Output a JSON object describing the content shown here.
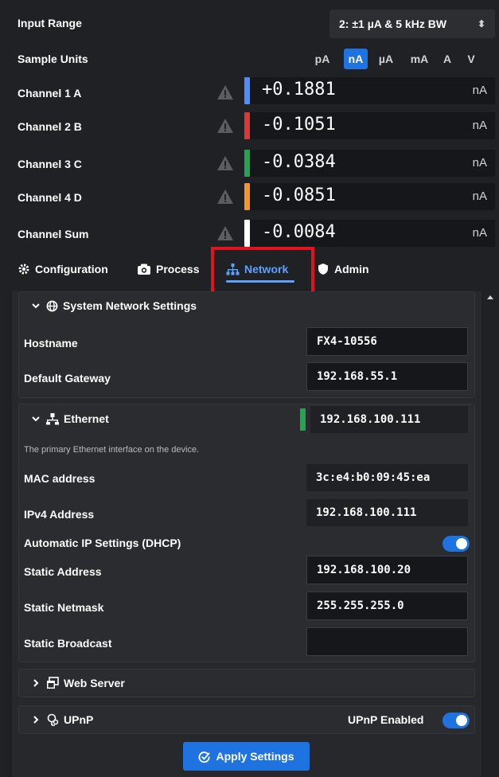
{
  "input_range": {
    "label": "Input Range",
    "value": "2: ±1 µA & 5 kHz BW"
  },
  "sample_units": {
    "label": "Sample Units",
    "options": [
      "pA",
      "nA",
      "µA",
      "mA",
      "A",
      "V"
    ],
    "selected": "nA"
  },
  "channels": [
    {
      "label": "Channel 1 A",
      "value": "+0.1881",
      "unit": "nA",
      "color": "#4d8dff"
    },
    {
      "label": "Channel 2 B",
      "value": "-0.1051",
      "unit": "nA",
      "color": "#d93a36"
    },
    {
      "label": "Channel 3 C",
      "value": "-0.0384",
      "unit": "nA",
      "color": "#23a453"
    },
    {
      "label": "Channel 4 D",
      "value": "-0.0851",
      "unit": "nA",
      "color": "#f5952a"
    },
    {
      "label": "Channel Sum",
      "value": "-0.0084",
      "unit": "nA",
      "color": "#ffffff"
    }
  ],
  "tabs": [
    {
      "label": "Configuration",
      "icon": "gear-icon"
    },
    {
      "label": "Process",
      "icon": "camera-icon"
    },
    {
      "label": "Network",
      "icon": "network-icon",
      "active": true
    },
    {
      "label": "Admin",
      "icon": "shield-icon"
    }
  ],
  "system_network": {
    "title": "System Network Settings",
    "hostname_label": "Hostname",
    "hostname": "FX4-10556",
    "gateway_label": "Default Gateway",
    "gateway": "192.168.55.1"
  },
  "ethernet": {
    "title": "Ethernet",
    "address": "192.168.100.111",
    "status_color": "#23a453",
    "description": "The primary Ethernet interface on the device.",
    "mac_label": "MAC address",
    "mac": "3c:e4:b0:09:45:ea",
    "ipv4_label": "IPv4 Address",
    "ipv4": "192.168.100.111",
    "dhcp_label": "Automatic IP Settings (DHCP)",
    "dhcp_enabled": true,
    "static_address_label": "Static Address",
    "static_address": "192.168.100.20",
    "static_netmask_label": "Static Netmask",
    "static_netmask": "255.255.255.0",
    "static_broadcast_label": "Static Broadcast",
    "static_broadcast": ""
  },
  "web_server": {
    "title": "Web Server"
  },
  "upnp": {
    "title": "UPnP",
    "enabled_label": "UPnP Enabled",
    "enabled": true
  },
  "apply_button": "Apply Settings",
  "colors": {
    "accent": "#1f73e0",
    "highlight": "#e0141f",
    "active_tab": "#5ea1ff"
  }
}
